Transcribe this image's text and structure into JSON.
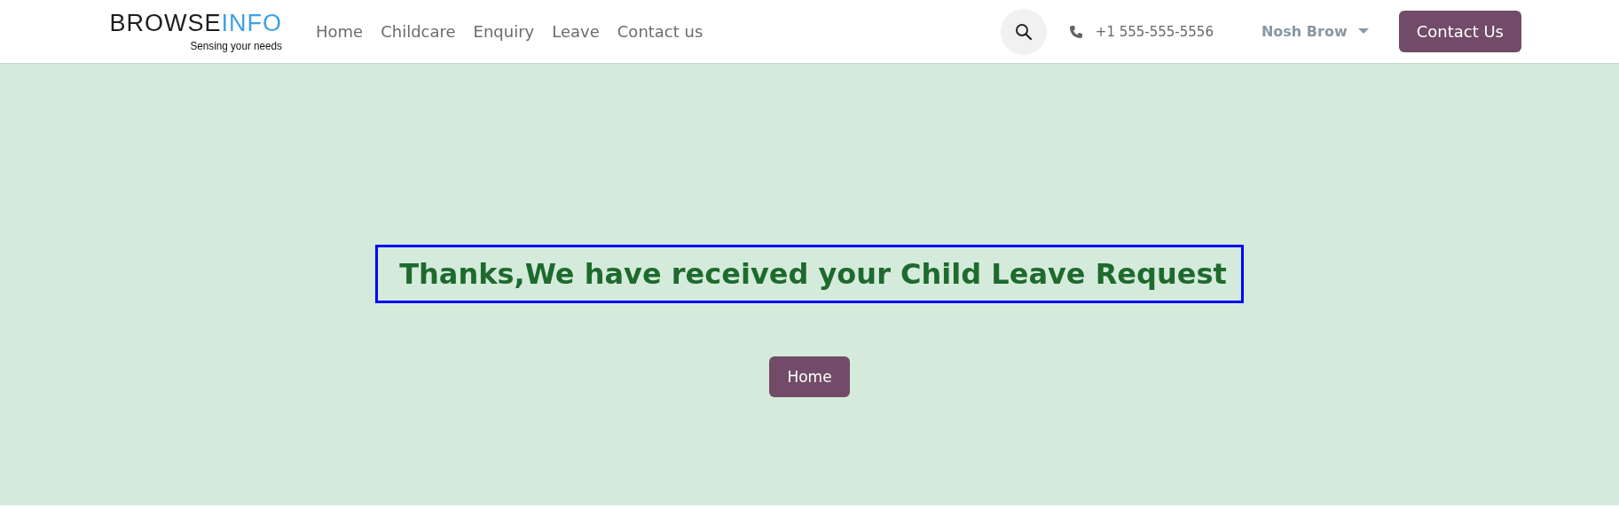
{
  "logo": {
    "primary": "BROWSE",
    "accent": "INFO",
    "tagline": "Sensing your needs"
  },
  "nav": [
    {
      "label": "Home"
    },
    {
      "label": "Childcare"
    },
    {
      "label": "Enquiry"
    },
    {
      "label": "Leave"
    },
    {
      "label": "Contact us"
    }
  ],
  "phone": "+1 555-555-5556",
  "user": "Nosh Brow",
  "contact_button": "Contact Us",
  "message": "Thanks,We have received your Child Leave Request",
  "home_button": "Home"
}
